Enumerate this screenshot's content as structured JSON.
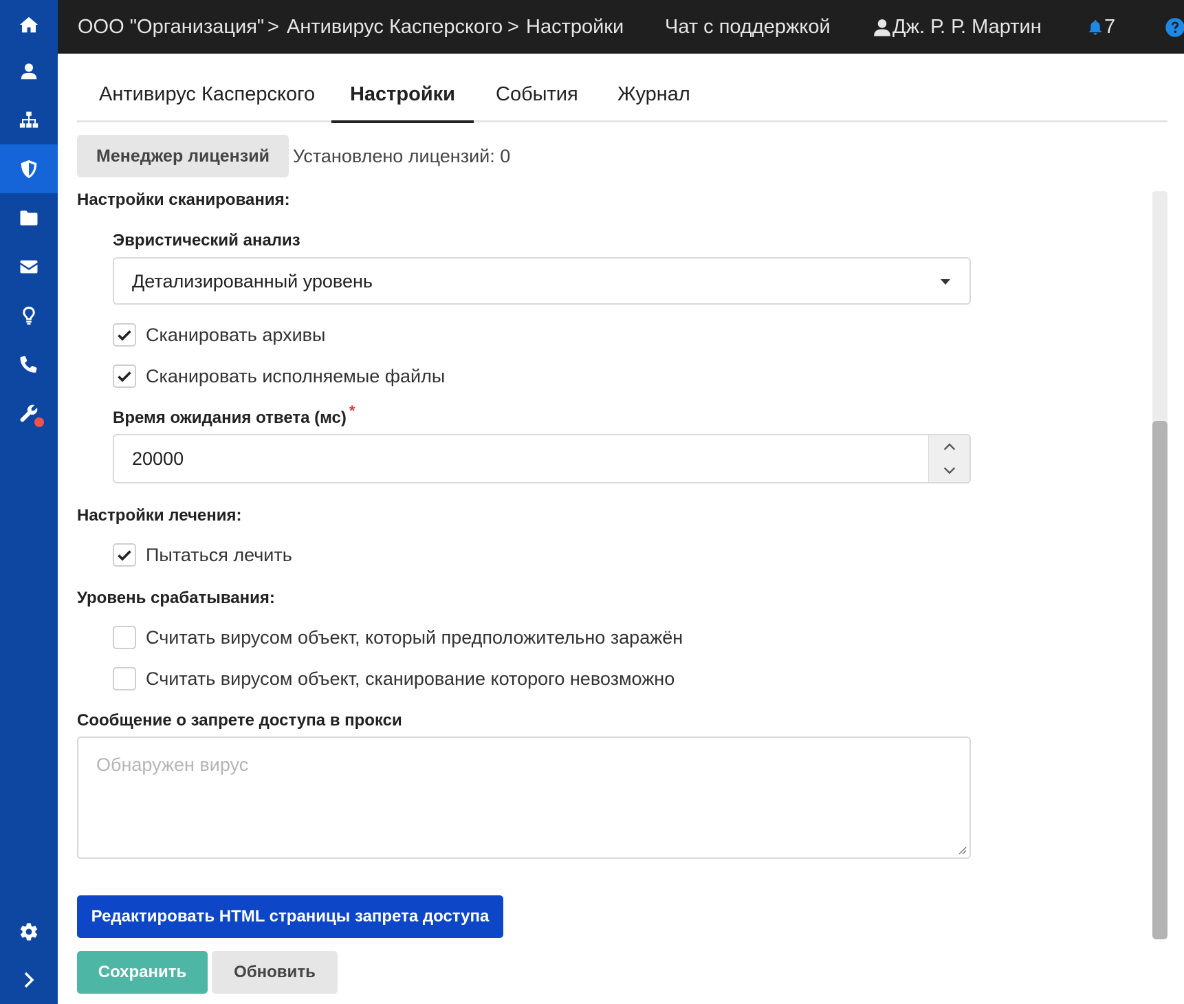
{
  "sidebar": {
    "items": [
      {
        "icon": "home-icon"
      },
      {
        "icon": "user-icon"
      },
      {
        "icon": "network-icon"
      },
      {
        "icon": "shield-icon",
        "active": true
      },
      {
        "icon": "folder-icon"
      },
      {
        "icon": "mail-icon"
      },
      {
        "icon": "lightbulb-icon"
      },
      {
        "icon": "phone-icon"
      },
      {
        "icon": "wrench-icon",
        "badge": true
      }
    ],
    "bottom": [
      {
        "icon": "gear-icon"
      },
      {
        "icon": "chevron-right-icon"
      }
    ],
    "colors": {
      "background": "#0d47a1",
      "active": "#1565d8",
      "badge": "#f0524d"
    }
  },
  "topbar": {
    "breadcrumb": [
      "ООО \"Организация\"",
      "Антивирус Касперского",
      "Настройки"
    ],
    "separator": ">",
    "support_chat": "Чат с поддержкой",
    "user_name": "Дж. Р. Р. Мартин",
    "notifications_count": "7",
    "colors": {
      "background": "#1f1f1f",
      "bell": "#1e88e5",
      "help": "#1e88e5"
    }
  },
  "tabs": [
    {
      "label": "Антивирус Касперского",
      "active": false
    },
    {
      "label": "Настройки",
      "active": true
    },
    {
      "label": "События",
      "active": false
    },
    {
      "label": "Журнал",
      "active": false
    }
  ],
  "license": {
    "button_label": "Менеджер лицензий",
    "installed_text": "Установлено лицензий: 0"
  },
  "scan_settings": {
    "title": "Настройки сканирования:",
    "heuristic": {
      "label": "Эвристический анализ",
      "selected": "Детализированный уровень"
    },
    "scan_archives": {
      "label": "Сканировать архивы",
      "checked": true
    },
    "scan_executables": {
      "label": "Сканировать исполняемые файлы",
      "checked": true
    },
    "timeout": {
      "label": "Время ожидания ответа (мс)",
      "required_mark": "*",
      "value": "20000"
    }
  },
  "cure_settings": {
    "title": "Настройки лечения:",
    "try_cure": {
      "label": "Пытаться лечить",
      "checked": true
    }
  },
  "trigger_level": {
    "title": "Уровень срабатывания:",
    "suspected": {
      "label": "Считать вирусом объект, который предположительно заражён",
      "checked": false
    },
    "unscannable": {
      "label": "Считать вирусом объект, сканирование которого невозможно",
      "checked": false
    }
  },
  "proxy_message": {
    "label": "Сообщение о запрете доступа в прокси",
    "placeholder": "Обнаружен вирус"
  },
  "buttons": {
    "edit_html": "Редактировать HTML страницы запрета доступа",
    "save": "Сохранить",
    "refresh": "Обновить",
    "colors": {
      "primary": "#0d47c7",
      "save": "#4db6a5",
      "secondary": "#e6e6e6"
    }
  }
}
